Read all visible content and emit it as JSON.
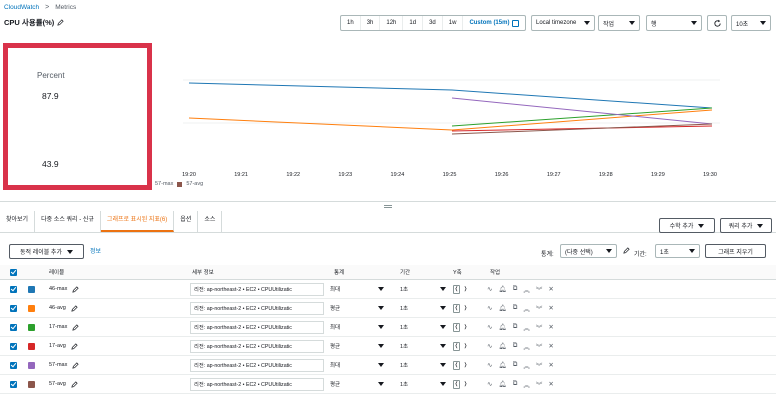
{
  "breadcrumb": {
    "root": "CloudWatch",
    "sep": ">",
    "current": "Metrics"
  },
  "title": "CPU 사용률(%)",
  "time_buttons": [
    "1h",
    "3h",
    "12h",
    "1d",
    "3d",
    "1w"
  ],
  "time_active": "Custom (15m)",
  "timezone": "Local timezone",
  "actions_label": "작업",
  "view_label": "행",
  "refresh_label": "10초",
  "chart_data": {
    "type": "line",
    "ylabel": "Percent",
    "yticks": [
      "87.9",
      "43.9"
    ],
    "x": [
      "19:20",
      "19:21",
      "19:22",
      "19:23",
      "19:24",
      "19:25",
      "19:26",
      "19:27",
      "19:28",
      "19:29",
      "19:30"
    ],
    "legend_visible": [
      "57-max",
      "57-avg"
    ],
    "colors": {
      "46-max": "#1f77b4",
      "46-avg": "#ff7f0e",
      "17-max": "#2ca02c",
      "17-avg": "#d62728",
      "57-max": "#9467bd",
      "57-avg": "#8c564b"
    }
  },
  "tabs": [
    "찾아보기",
    "다중 소스 쿼리 - 신규",
    "그래프로 표시된 지표(6)",
    "옵션",
    "소스"
  ],
  "add_math": "수학 추가",
  "add_query": "쿼리 추가",
  "dynamic_label_btn": "동적 레이블 추가",
  "info_link": "정보",
  "stat_label": "통계:",
  "stat_value": "(다중 선택)",
  "period_label": "기간:",
  "period_value": "1초",
  "clear_graph": "그래프 지우기",
  "columns": [
    "레이블",
    "세부 정보",
    "통계",
    "기간",
    "Y축",
    "작업"
  ],
  "rows": [
    {
      "label": "46-max",
      "color": "#1f77b4",
      "detail": "리전: ap-northeast-2 • EC2 • CPUUtilizatic",
      "stat": "최대",
      "period": "1초"
    },
    {
      "label": "46-avg",
      "color": "#ff7f0e",
      "detail": "리전: ap-northeast-2 • EC2 • CPUUtilizatic",
      "stat": "평균",
      "period": "1초"
    },
    {
      "label": "17-max",
      "color": "#2ca02c",
      "detail": "리전: ap-northeast-2 • EC2 • CPUUtilizatic",
      "stat": "최대",
      "period": "1초"
    },
    {
      "label": "17-avg",
      "color": "#d62728",
      "detail": "리전: ap-northeast-2 • EC2 • CPUUtilizatic",
      "stat": "평균",
      "period": "1초"
    },
    {
      "label": "57-max",
      "color": "#9467bd",
      "detail": "리전: ap-northeast-2 • EC2 • CPUUtilizatic",
      "stat": "최대",
      "period": "1초"
    },
    {
      "label": "57-avg",
      "color": "#8c564b",
      "detail": "리전: ap-northeast-2 • EC2 • CPUUtilizatic",
      "stat": "평균",
      "period": "1초"
    }
  ]
}
